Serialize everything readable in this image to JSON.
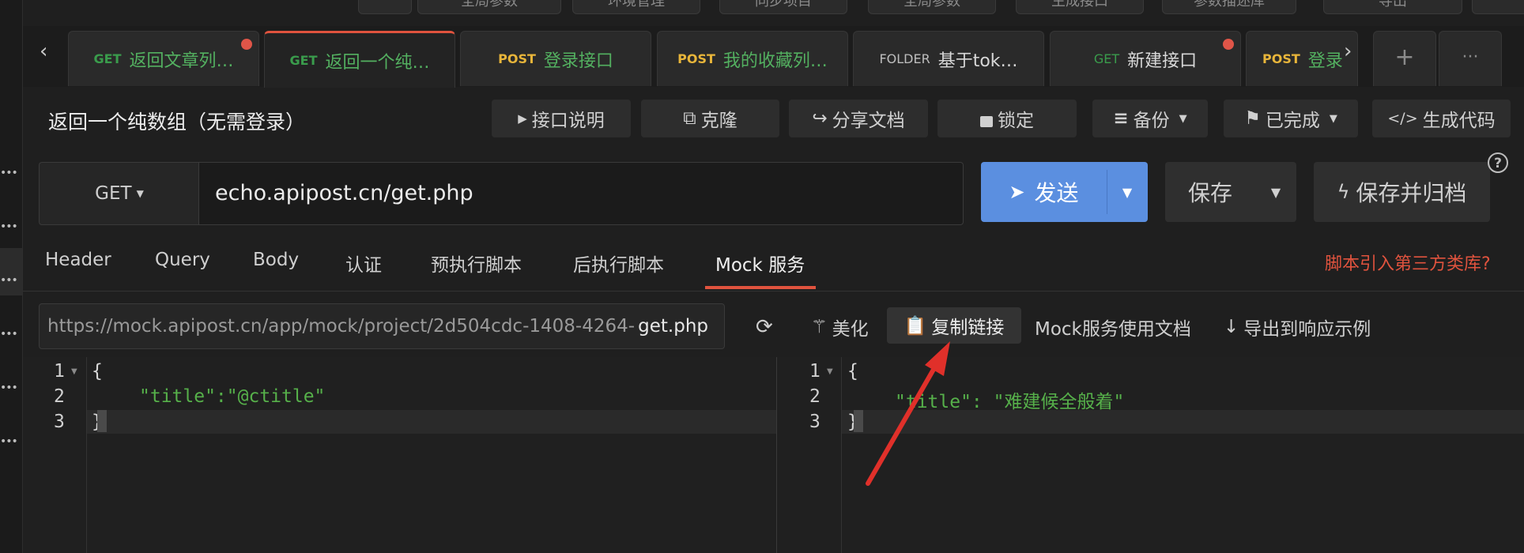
{
  "top_toolbar": [
    "全局参数",
    "环境管理",
    "同步项目",
    "全局参数",
    "生成接口",
    "参数描述库",
    "导出"
  ],
  "tabs": [
    {
      "method": "GET",
      "name": "返回文章列…",
      "style": "get",
      "modified": true
    },
    {
      "method": "GET",
      "name": "返回一个纯…",
      "style": "get",
      "active": true
    },
    {
      "method": "POST",
      "name": "登录接口",
      "style": "post"
    },
    {
      "method": "POST",
      "name": "我的收藏列…",
      "style": "post"
    },
    {
      "method": "FOLDER",
      "name": "基于tok…",
      "style": "folder"
    },
    {
      "method": "GET",
      "name": "新建接口",
      "style": "get-plain",
      "modified": true
    },
    {
      "method": "POST",
      "name": "登录",
      "style": "post"
    }
  ],
  "nav": {
    "prev": "‹",
    "next": "›",
    "plus": "+",
    "more": "···"
  },
  "api": {
    "title": "返回一个纯数组（无需登录）",
    "actions": [
      {
        "icon": "play-icon",
        "glyph": "▶",
        "label": "接口说明"
      },
      {
        "icon": "copy-icon",
        "glyph": "⧉",
        "label": "克隆"
      },
      {
        "icon": "share-icon",
        "glyph": "↪",
        "label": "分享文档"
      },
      {
        "icon": "lock-icon",
        "glyph": "🔒",
        "label": "锁定"
      },
      {
        "icon": "database-icon",
        "glyph": "≡",
        "label": "备份",
        "caret": true
      },
      {
        "icon": "flag-icon",
        "glyph": "⚑",
        "label": "已完成",
        "caret": true
      },
      {
        "icon": "code-icon",
        "glyph": "</>",
        "label": "生成代码"
      }
    ]
  },
  "request": {
    "method": "GET",
    "url": "echo.apipost.cn/get.php",
    "send": "发送",
    "save": "保存",
    "save_archive": "保存并归档",
    "help": "?"
  },
  "req_tabs": [
    {
      "label": "Header"
    },
    {
      "label": "Query"
    },
    {
      "label": "Body"
    },
    {
      "label": "认证"
    },
    {
      "label": "预执行脚本"
    },
    {
      "label": "后执行脚本"
    },
    {
      "label": "Mock 服务",
      "active": true
    }
  ],
  "script_link": "脚本引入第三方类库?",
  "mock": {
    "url_prefix": "https://mock.apipost.cn/app/mock/project/2d504cdc-1408-4264-",
    "url_suffix": "get.php",
    "beautify": "美化",
    "copy_link": "复制链接",
    "docs": "Mock服务使用文档",
    "export": "导出到响应示例"
  },
  "editor_left": {
    "lines": [
      "{",
      "\"title\":\"@ctitle\"",
      "}"
    ]
  },
  "editor_right": {
    "lines": [
      "{",
      "\"title\": \"难建候全般着\"",
      "}"
    ]
  },
  "colors": {
    "accent": "#5b8fe0",
    "active_tab": "#e0533e",
    "get": "#3a9c4c",
    "post": "#e8b53a",
    "annotation": "#e0302a"
  }
}
